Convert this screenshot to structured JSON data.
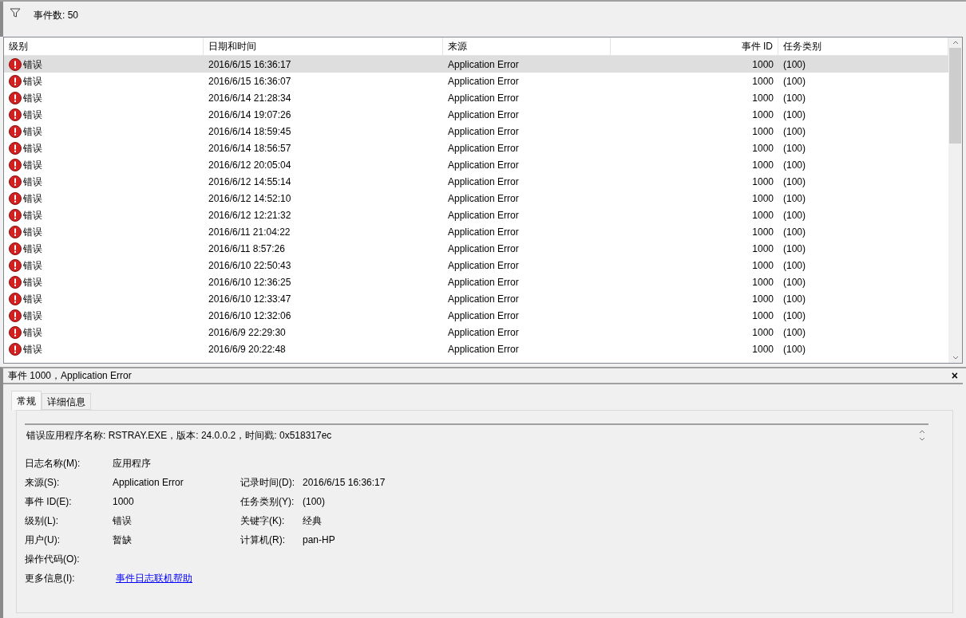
{
  "toolbar": {
    "event_count": "事件数: 50"
  },
  "table": {
    "columns": [
      "级别",
      "日期和时间",
      "来源",
      "事件 ID",
      "任务类别"
    ],
    "rows": [
      {
        "level": "错误",
        "datetime": "2016/6/15 16:36:17",
        "source": "Application Error",
        "event_id": "1000",
        "task": "(100)",
        "selected": true
      },
      {
        "level": "错误",
        "datetime": "2016/6/15 16:36:07",
        "source": "Application Error",
        "event_id": "1000",
        "task": "(100)",
        "selected": false
      },
      {
        "level": "错误",
        "datetime": "2016/6/14 21:28:34",
        "source": "Application Error",
        "event_id": "1000",
        "task": "(100)",
        "selected": false
      },
      {
        "level": "错误",
        "datetime": "2016/6/14 19:07:26",
        "source": "Application Error",
        "event_id": "1000",
        "task": "(100)",
        "selected": false
      },
      {
        "level": "错误",
        "datetime": "2016/6/14 18:59:45",
        "source": "Application Error",
        "event_id": "1000",
        "task": "(100)",
        "selected": false
      },
      {
        "level": "错误",
        "datetime": "2016/6/14 18:56:57",
        "source": "Application Error",
        "event_id": "1000",
        "task": "(100)",
        "selected": false
      },
      {
        "level": "错误",
        "datetime": "2016/6/12 20:05:04",
        "source": "Application Error",
        "event_id": "1000",
        "task": "(100)",
        "selected": false
      },
      {
        "level": "错误",
        "datetime": "2016/6/12 14:55:14",
        "source": "Application Error",
        "event_id": "1000",
        "task": "(100)",
        "selected": false
      },
      {
        "level": "错误",
        "datetime": "2016/6/12 14:52:10",
        "source": "Application Error",
        "event_id": "1000",
        "task": "(100)",
        "selected": false
      },
      {
        "level": "错误",
        "datetime": "2016/6/12 12:21:32",
        "source": "Application Error",
        "event_id": "1000",
        "task": "(100)",
        "selected": false
      },
      {
        "level": "错误",
        "datetime": "2016/6/11 21:04:22",
        "source": "Application Error",
        "event_id": "1000",
        "task": "(100)",
        "selected": false
      },
      {
        "level": "错误",
        "datetime": "2016/6/11 8:57:26",
        "source": "Application Error",
        "event_id": "1000",
        "task": "(100)",
        "selected": false
      },
      {
        "level": "错误",
        "datetime": "2016/6/10 22:50:43",
        "source": "Application Error",
        "event_id": "1000",
        "task": "(100)",
        "selected": false
      },
      {
        "level": "错误",
        "datetime": "2016/6/10 12:36:25",
        "source": "Application Error",
        "event_id": "1000",
        "task": "(100)",
        "selected": false
      },
      {
        "level": "错误",
        "datetime": "2016/6/10 12:33:47",
        "source": "Application Error",
        "event_id": "1000",
        "task": "(100)",
        "selected": false
      },
      {
        "level": "错误",
        "datetime": "2016/6/10 12:32:06",
        "source": "Application Error",
        "event_id": "1000",
        "task": "(100)",
        "selected": false
      },
      {
        "level": "错误",
        "datetime": "2016/6/9 22:29:30",
        "source": "Application Error",
        "event_id": "1000",
        "task": "(100)",
        "selected": false
      },
      {
        "level": "错误",
        "datetime": "2016/6/9 20:22:48",
        "source": "Application Error",
        "event_id": "1000",
        "task": "(100)",
        "selected": false
      }
    ]
  },
  "details": {
    "title": "事件 1000，Application Error",
    "close": "×",
    "tabs": [
      {
        "label": "常规",
        "selected": true
      },
      {
        "label": "详细信息",
        "selected": false
      }
    ],
    "description": "错误应用程序名称: RSTRAY.EXE，版本: 24.0.0.2，时间戳: 0x518317ec",
    "fields": [
      [
        {
          "label": "日志名称(M):",
          "value": "应用程序"
        }
      ],
      [
        {
          "label": "来源(S):",
          "value": "Application Error"
        },
        {
          "label": "记录时间(D):",
          "value": "2016/6/15 16:36:17"
        }
      ],
      [
        {
          "label": "事件 ID(E):",
          "value": "1000"
        },
        {
          "label": "任务类别(Y):",
          "value": "(100)"
        }
      ],
      [
        {
          "label": "级别(L):",
          "value": "错误"
        },
        {
          "label": "关键字(K):",
          "value": "经典"
        }
      ],
      [
        {
          "label": "用户(U):",
          "value": "暂缺"
        },
        {
          "label": "计算机(R):",
          "value": "pan-HP"
        }
      ],
      [
        {
          "label": "操作代码(O):"
        }
      ],
      [
        {
          "label": "更多信息(I):",
          "link": "事件日志联机帮助"
        }
      ]
    ]
  }
}
